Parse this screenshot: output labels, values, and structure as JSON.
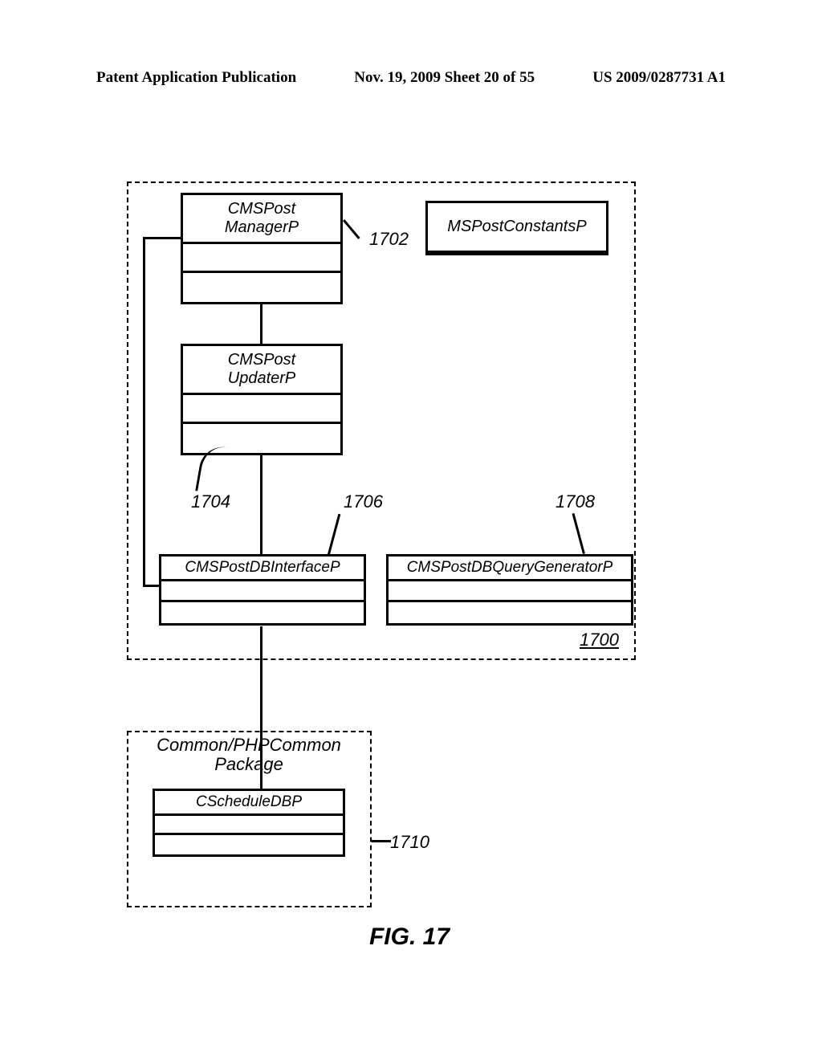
{
  "header": {
    "left": "Patent Application Publication",
    "center": "Nov. 19, 2009  Sheet 20 of 55",
    "right": "US 2009/0287731 A1"
  },
  "classes": {
    "manager": "CMSPost\nManagerP",
    "constants": "MSPostConstantsP",
    "updater": "CMSPost\nUpdaterP",
    "dbinterface": "CMSPostDBInterfaceP",
    "dbquery": "CMSPostDBQueryGeneratorP",
    "schedule": "CScheduleDBP"
  },
  "packages": {
    "common_title": "Common/PHPCommon\nPackage"
  },
  "refs": {
    "r1700": "1700",
    "r1702": "1702",
    "r1704": "1704",
    "r1706": "1706",
    "r1708": "1708",
    "r1710": "1710"
  },
  "figure_caption": "FIG. 17"
}
